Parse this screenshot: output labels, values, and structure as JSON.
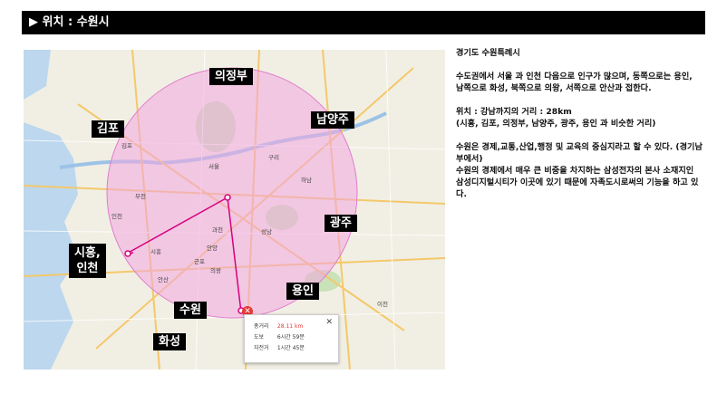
{
  "header": {
    "title": "▶ 위치 : 수원시"
  },
  "map": {
    "labels": {
      "uijeongbu": "의정부",
      "gimpo": "김포",
      "namyangju": "남양주",
      "gwangju": "광주",
      "siheung_incheon": "시흥,\n인천",
      "yongin": "용인",
      "suwon": "수원",
      "hwaseong": "화성"
    },
    "small_labels": {
      "seoul": "서울",
      "incheon": "인천",
      "bucheon": "부천",
      "anyang": "안양",
      "gwacheon": "과천",
      "gunpo": "군포",
      "uiwang": "의왕",
      "ansan": "안산",
      "siheung": "시흥",
      "guri": "구리",
      "hanam": "하남",
      "seongnam": "성남",
      "gimpo": "김포",
      "icheon": "이천"
    },
    "popup": {
      "distance_label": "총거리",
      "distance_value": "28.11 km",
      "walk_label": "도보",
      "walk_value": "6시간 59분",
      "bike_label": "자전거",
      "bike_value": "1시간 45분",
      "close": "✕"
    },
    "colors": {
      "circle_fill": "#f2a6e0",
      "route": "#d6007e",
      "marker": "#e53935"
    }
  },
  "text": {
    "p1": "경기도 수원특례시",
    "p2": "수도권에서 서울 과 인천 다음으로 인구가 많으며, 동쪽으로는 용인, 남쪽으로 화성, 북쪽으로 의왕, 서쪽으로 안산과 접한다.",
    "p3_line1": "위치 : 강남까지의 거리 : 28km",
    "p3_line2": "(시흥, 김포, 의정부, 남양주, 광주, 용인 과 비슷한 거리)",
    "p4_line1": "수원은 경제,교통,산업,행정 및 교육의 중심지라고 할 수 있다. (경기남부에서)",
    "p4_line2": "수원의 경제에서 매우 큰 비중을 차지하는 삼성전자의 본사 소재지인 삼성디지털시티가 이곳에 있기 때문에 자족도시로써의 기능을 하고 있다."
  }
}
